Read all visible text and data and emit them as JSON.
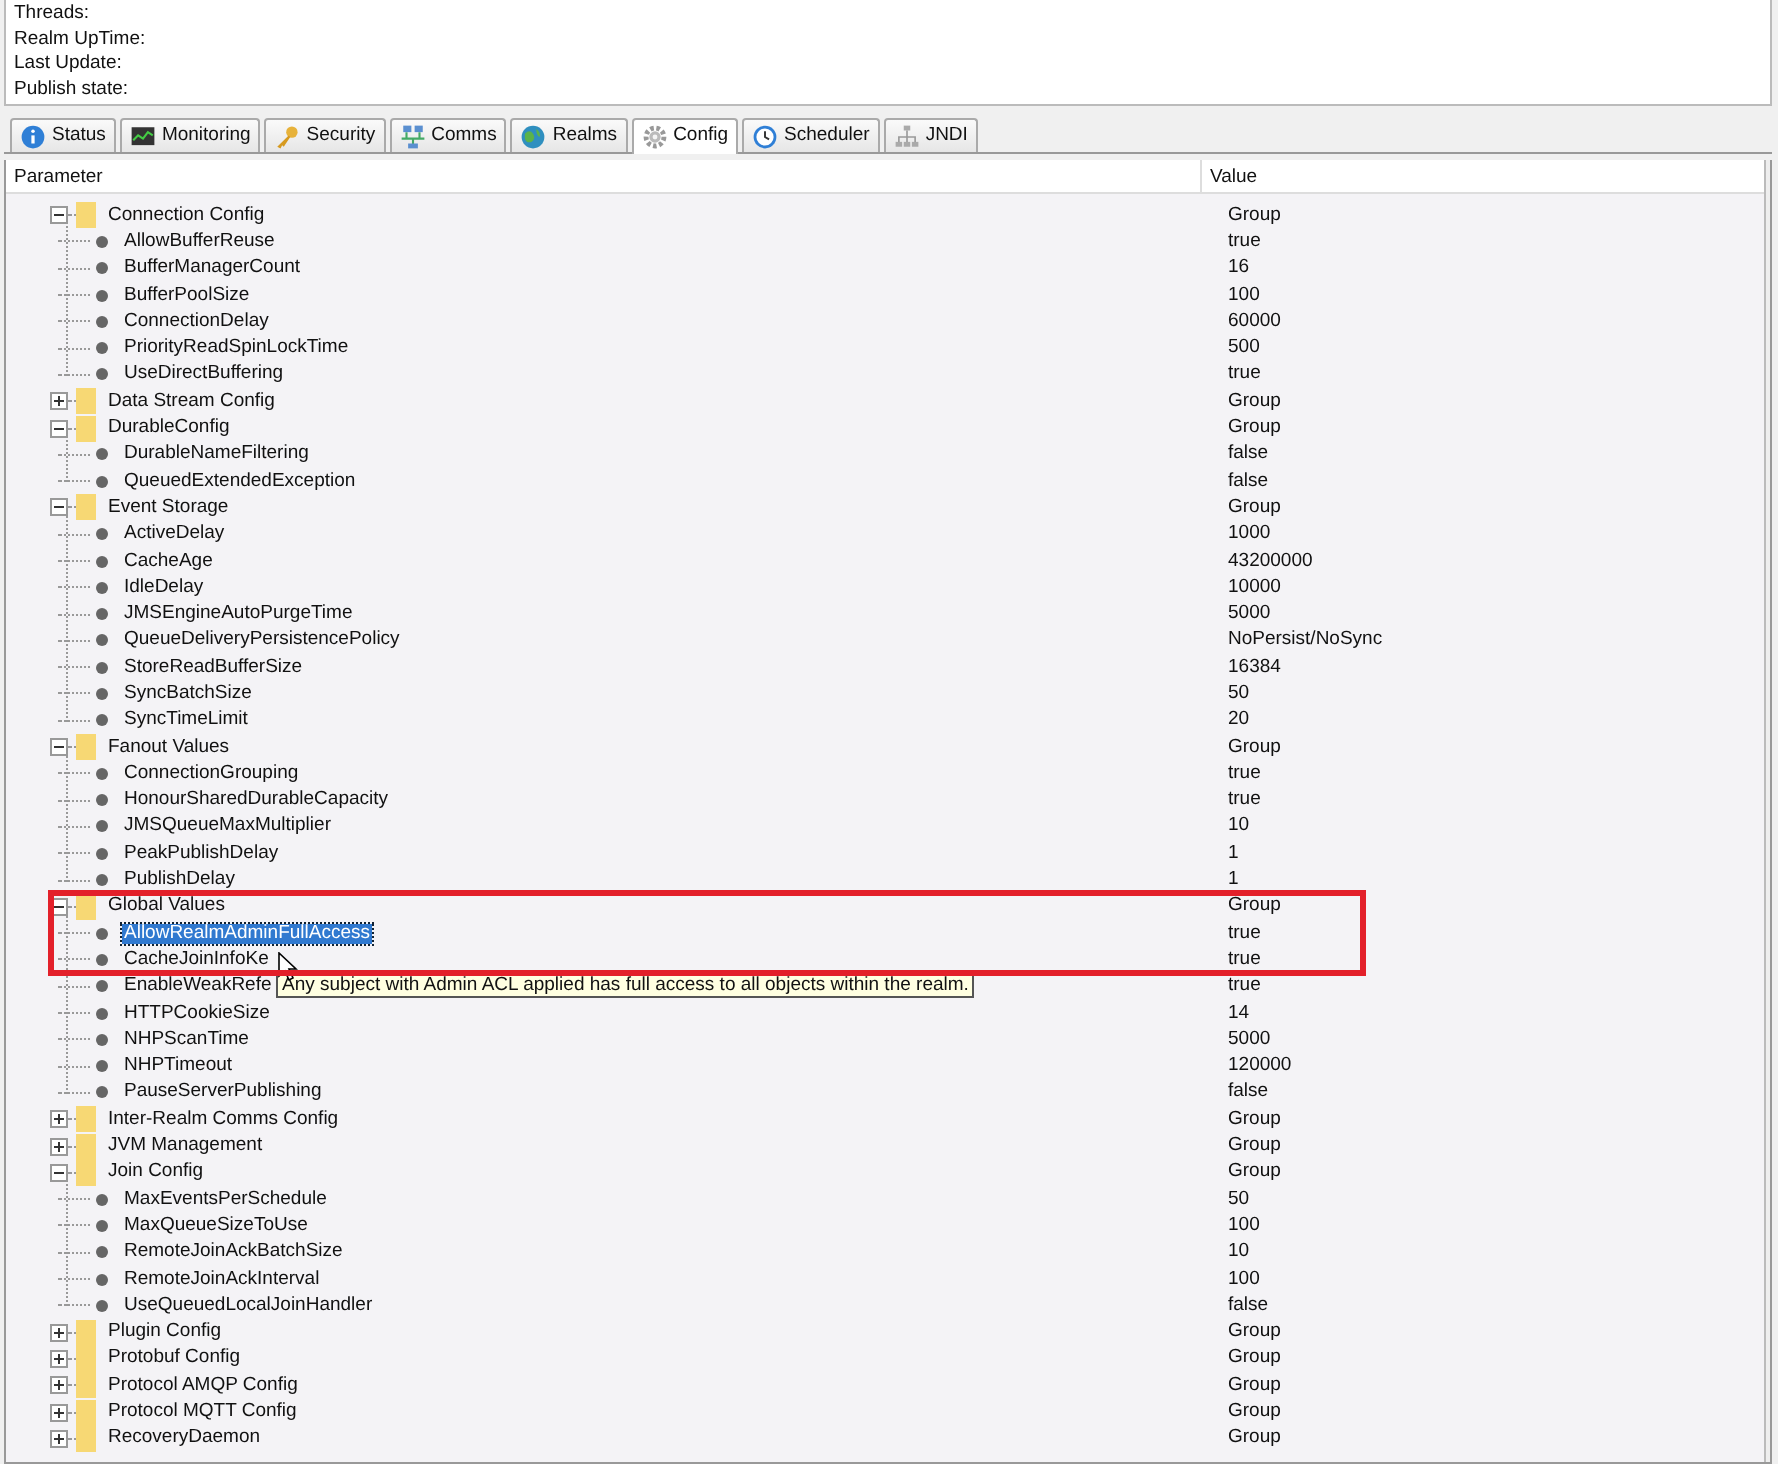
{
  "info_panel": {
    "labels": [
      "Threads:",
      "Realm UpTime:",
      "Last Update:",
      "Publish state:"
    ]
  },
  "tabs": [
    {
      "label": "Status",
      "selected": false
    },
    {
      "label": "Monitoring",
      "selected": false
    },
    {
      "label": "Security",
      "selected": false
    },
    {
      "label": "Comms",
      "selected": false
    },
    {
      "label": "Realms",
      "selected": false
    },
    {
      "label": "Config",
      "selected": true
    },
    {
      "label": "Scheduler",
      "selected": false
    },
    {
      "label": "JNDI",
      "selected": false
    }
  ],
  "table": {
    "columns": [
      "Parameter",
      "Value"
    ],
    "rows": [
      {
        "name": "Connection Config",
        "value": "Group",
        "expanded": true,
        "highlighted": false,
        "selected": false,
        "children": [
          {
            "name": "AllowBufferReuse",
            "value": "true",
            "selected": false
          },
          {
            "name": "BufferManagerCount",
            "value": "16",
            "selected": false
          },
          {
            "name": "BufferPoolSize",
            "value": "100",
            "selected": false
          },
          {
            "name": "ConnectionDelay",
            "value": "60000",
            "selected": false
          },
          {
            "name": "PriorityReadSpinLockTime",
            "value": "500",
            "selected": false
          },
          {
            "name": "UseDirectBuffering",
            "value": "true",
            "selected": false
          }
        ]
      },
      {
        "name": "Data Stream Config",
        "value": "Group",
        "expanded": false,
        "highlighted": false,
        "selected": false
      },
      {
        "name": "DurableConfig",
        "value": "Group",
        "expanded": true,
        "highlighted": false,
        "selected": false,
        "children": [
          {
            "name": "DurableNameFiltering",
            "value": "false",
            "selected": false
          },
          {
            "name": "QueuedExtendedException",
            "value": "false",
            "selected": false
          }
        ]
      },
      {
        "name": "Event Storage",
        "value": "Group",
        "expanded": true,
        "highlighted": false,
        "selected": false,
        "children": [
          {
            "name": "ActiveDelay",
            "value": "1000",
            "selected": false
          },
          {
            "name": "CacheAge",
            "value": "43200000",
            "selected": false
          },
          {
            "name": "IdleDelay",
            "value": "10000",
            "selected": false
          },
          {
            "name": "JMSEngineAutoPurgeTime",
            "value": "5000",
            "selected": false
          },
          {
            "name": "QueueDeliveryPersistencePolicy",
            "value": "NoPersist/NoSync",
            "selected": false
          },
          {
            "name": "StoreReadBufferSize",
            "value": "16384",
            "selected": false
          },
          {
            "name": "SyncBatchSize",
            "value": "50",
            "selected": false
          },
          {
            "name": "SyncTimeLimit",
            "value": "20",
            "selected": false
          }
        ]
      },
      {
        "name": "Fanout Values",
        "value": "Group",
        "expanded": true,
        "highlighted": false,
        "selected": false,
        "children": [
          {
            "name": "ConnectionGrouping",
            "value": "true",
            "selected": false
          },
          {
            "name": "HonourSharedDurableCapacity",
            "value": "true",
            "selected": false
          },
          {
            "name": "JMSQueueMaxMultiplier",
            "value": "10",
            "selected": false
          },
          {
            "name": "PeakPublishDelay",
            "value": "1",
            "selected": false
          },
          {
            "name": "PublishDelay",
            "value": "1",
            "selected": false
          }
        ]
      },
      {
        "name": "Global Values",
        "value": "Group",
        "expanded": true,
        "highlighted": true,
        "selected": false,
        "children": [
          {
            "name": "AllowRealmAdminFullAccess",
            "value": "true",
            "selected": true,
            "tooltip": "Any subject with Admin ACL applied has full access to all objects within the realm."
          },
          {
            "name": "CacheJoinInfoKe",
            "value": "true",
            "selected": false
          },
          {
            "name": "EnableWeakRefe",
            "value": "true",
            "selected": false
          },
          {
            "name": "HTTPCookieSize",
            "value": "14",
            "selected": false
          },
          {
            "name": "NHPScanTime",
            "value": "5000",
            "selected": false
          },
          {
            "name": "NHPTimeout",
            "value": "120000",
            "selected": false
          },
          {
            "name": "PauseServerPublishing",
            "value": "false",
            "selected": false
          }
        ]
      },
      {
        "name": "Inter-Realm Comms Config",
        "value": "Group",
        "expanded": false,
        "highlighted": false,
        "selected": false
      },
      {
        "name": "JVM Management",
        "value": "Group",
        "expanded": false,
        "highlighted": false,
        "selected": false
      },
      {
        "name": "Join Config",
        "value": "Group",
        "expanded": true,
        "highlighted": false,
        "selected": false,
        "children": [
          {
            "name": "MaxEventsPerSchedule",
            "value": "50",
            "selected": false
          },
          {
            "name": "MaxQueueSizeToUse",
            "value": "100",
            "selected": false
          },
          {
            "name": "RemoteJoinAckBatchSize",
            "value": "10",
            "selected": false
          },
          {
            "name": "RemoteJoinAckInterval",
            "value": "100",
            "selected": false
          },
          {
            "name": "UseQueuedLocalJoinHandler",
            "value": "false",
            "selected": false
          }
        ]
      },
      {
        "name": "Plugin Config",
        "value": "Group",
        "expanded": false,
        "highlighted": false,
        "selected": false
      },
      {
        "name": "Protobuf Config",
        "value": "Group",
        "expanded": false,
        "highlighted": false,
        "selected": false
      },
      {
        "name": "Protocol AMQP Config",
        "value": "Group",
        "expanded": false,
        "highlighted": false,
        "selected": false
      },
      {
        "name": "Protocol MQTT Config",
        "value": "Group",
        "expanded": false,
        "highlighted": false,
        "selected": false
      },
      {
        "name": "RecoveryDaemon",
        "value": "Group",
        "expanded": false,
        "highlighted": false,
        "selected": false
      }
    ]
  }
}
